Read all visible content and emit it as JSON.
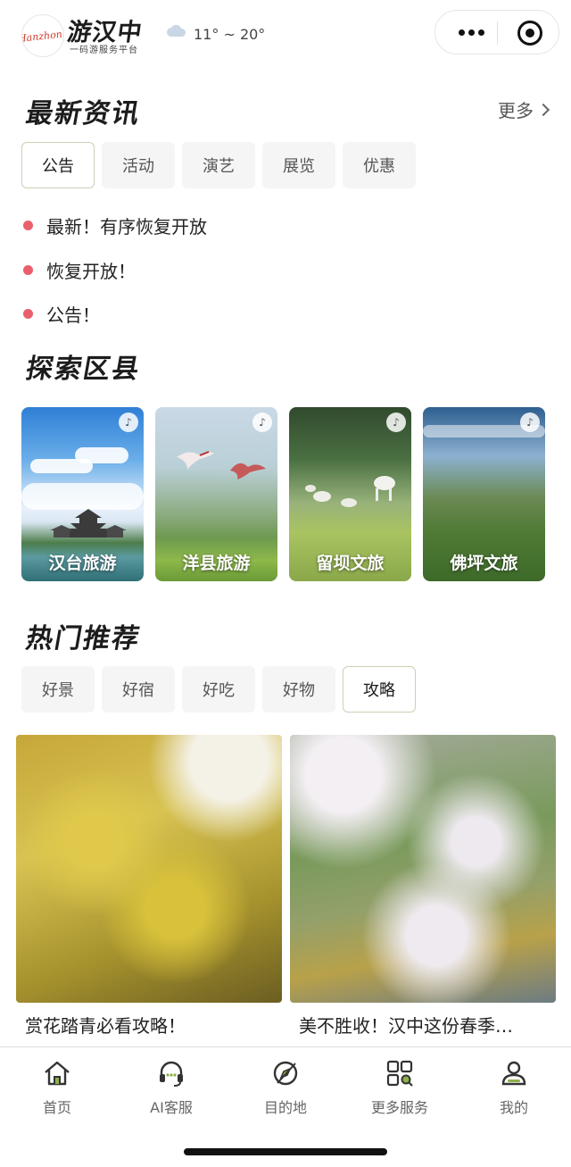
{
  "header": {
    "logo_script": "Hanzhong",
    "app_name": "游汉中",
    "app_subtitle": "一码游服务平台",
    "weather": {
      "icon": "cloud-icon",
      "temperature": "11° ~ 20°"
    }
  },
  "news": {
    "title": "最新资讯",
    "more_label": "更多",
    "tabs": [
      "公告",
      "活动",
      "演艺",
      "展览",
      "优惠"
    ],
    "active_tab": 0,
    "items": [
      "最新！有序恢复开放",
      "恢复开放！",
      "公告！"
    ],
    "dot_color": "#ea5f6c"
  },
  "districts": {
    "title": "探索区县",
    "items": [
      {
        "label": "汉台旅游"
      },
      {
        "label": "洋县旅游"
      },
      {
        "label": "留坝文旅"
      },
      {
        "label": "佛坪文旅"
      }
    ]
  },
  "hot": {
    "title": "热门推荐",
    "tabs": [
      "好景",
      "好宿",
      "好吃",
      "好物",
      "攻略"
    ],
    "active_tab": 4,
    "cards": [
      {
        "title": "赏花踏青必看攻略！"
      },
      {
        "title": "美不胜收！汉中这份春季…"
      }
    ]
  },
  "tabbar": {
    "items": [
      {
        "label": "首页",
        "icon": "home-icon"
      },
      {
        "label": "AI客服",
        "icon": "headset-icon"
      },
      {
        "label": "目的地",
        "icon": "compass-icon"
      },
      {
        "label": "更多服务",
        "icon": "grid-search-icon"
      },
      {
        "label": "我的",
        "icon": "user-icon"
      }
    ]
  },
  "colors": {
    "accent_border": "#c7d3b5",
    "tab_bg": "#f5f5f5"
  }
}
